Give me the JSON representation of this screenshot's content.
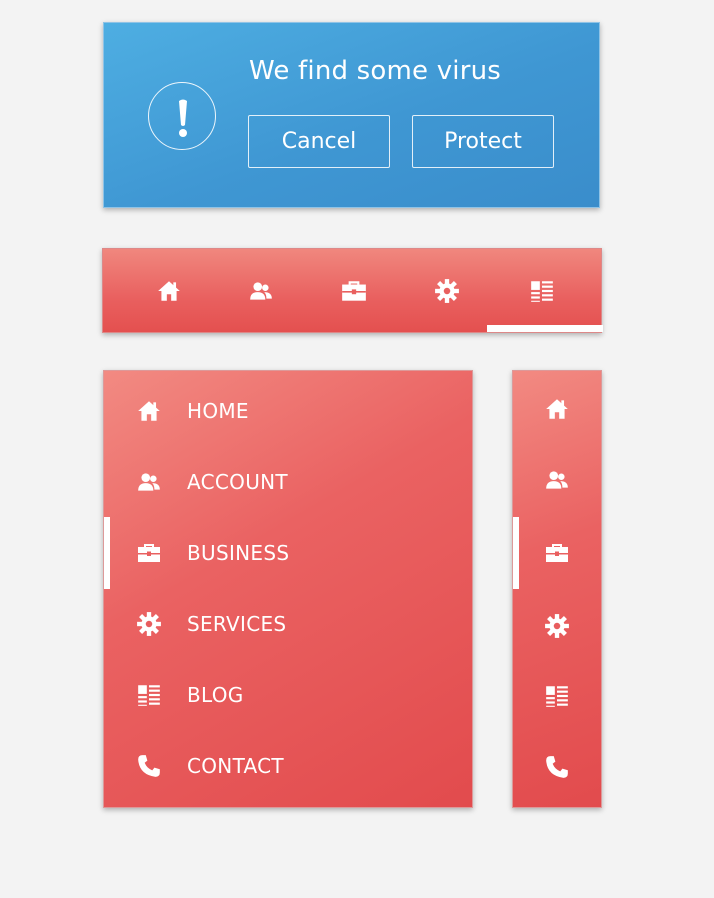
{
  "alert": {
    "title": "We find some virus",
    "icon": "exclamation-icon",
    "cancel_label": "Cancel",
    "protect_label": "Protect",
    "background": "#4aa6dd"
  },
  "tabbar": {
    "tabs": [
      {
        "icon": "home-icon"
      },
      {
        "icon": "account-icon"
      },
      {
        "icon": "briefcase-icon"
      },
      {
        "icon": "gear-icon"
      },
      {
        "icon": "blog-icon",
        "active": true
      }
    ],
    "accent": "#e85a5a"
  },
  "sidemenu": {
    "items": [
      {
        "label": "HOME",
        "icon": "home-icon"
      },
      {
        "label": "ACCOUNT",
        "icon": "account-icon"
      },
      {
        "label": "BUSINESS",
        "icon": "briefcase-icon",
        "active": true
      },
      {
        "label": "SERVICES",
        "icon": "gear-icon"
      },
      {
        "label": "BLOG",
        "icon": "blog-icon"
      },
      {
        "label": "CONTACT",
        "icon": "phone-icon"
      }
    ]
  },
  "sidemini": {
    "items": [
      {
        "icon": "home-icon"
      },
      {
        "icon": "account-icon"
      },
      {
        "icon": "briefcase-icon",
        "active": true
      },
      {
        "icon": "gear-icon"
      },
      {
        "icon": "blog-icon"
      },
      {
        "icon": "phone-icon"
      }
    ]
  }
}
